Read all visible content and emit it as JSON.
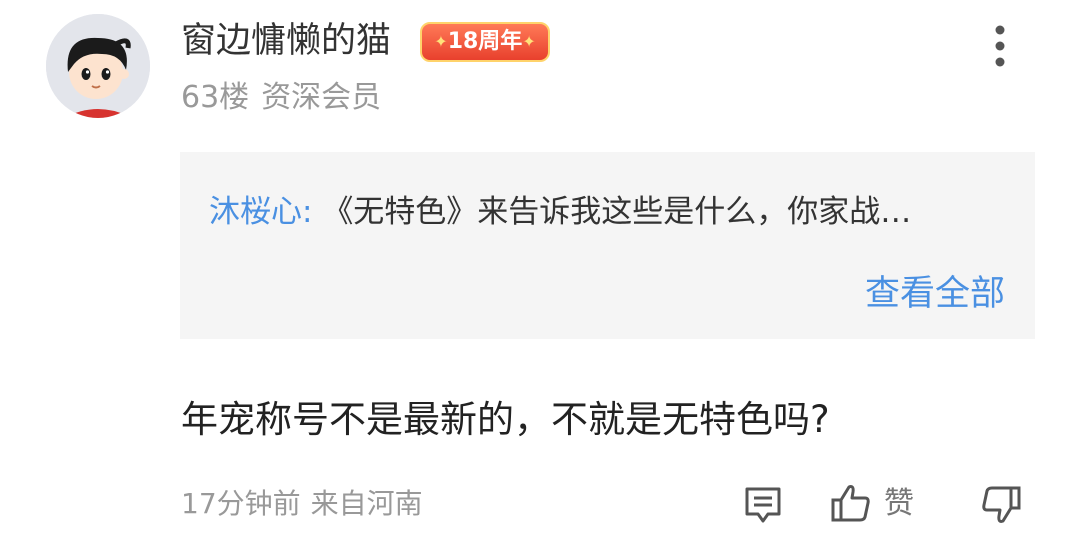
{
  "post": {
    "username": "窗边慵懒的猫",
    "badge": "18周年",
    "floor": "63楼",
    "member_level": "资深会员"
  },
  "quote": {
    "user": "沐桜心:",
    "text": "《无特色》来告诉我这些是什么，你家战…",
    "view_all": "查看全部"
  },
  "comment": {
    "text": "年宠称号不是最新的，不就是无特色吗?"
  },
  "footer": {
    "time": "17分钟前",
    "location": "来自河南",
    "like_label": "赞"
  },
  "icons": {
    "more": "more-vertical-icon",
    "reply": "comment-icon",
    "like": "thumbs-up-icon",
    "dislike": "thumbs-down-icon"
  },
  "colors": {
    "link_blue": "#4a90e2",
    "badge_red": "#e8402d",
    "quote_bg": "#f5f5f5",
    "meta_gray": "#999999"
  }
}
